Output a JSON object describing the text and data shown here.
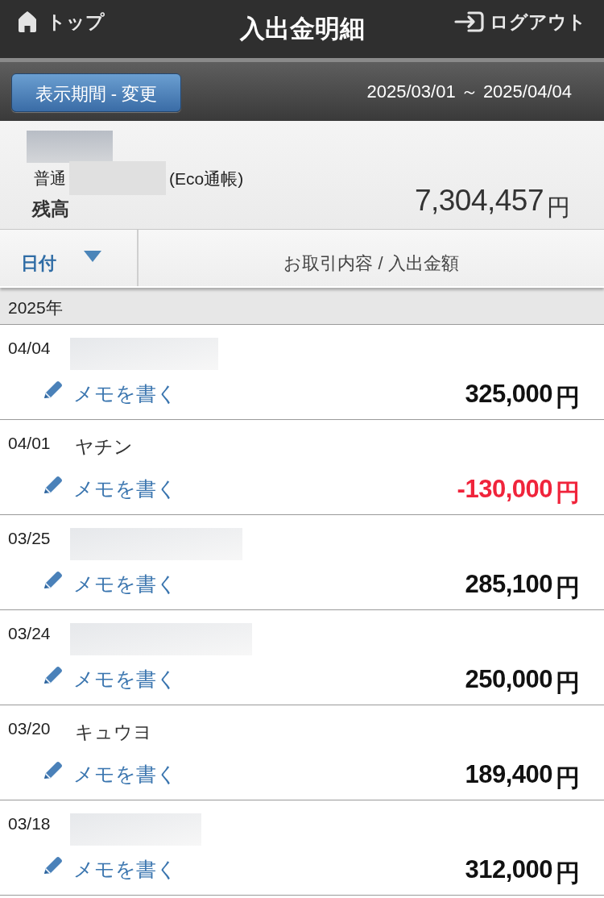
{
  "nav": {
    "home_label": "トップ",
    "title": "入出金明細",
    "logout_label": "ログアウト"
  },
  "toolbar": {
    "period_button": "表示期間 - 変更",
    "date_range": "2025/03/01 ～ 2025/04/04"
  },
  "account": {
    "name_redacted": true,
    "type": "普通",
    "number_redacted": true,
    "passbook": "(Eco通帳)",
    "balance_label": "残高",
    "balance": "7,304,457",
    "balance_unit": "円"
  },
  "columns": [
    {
      "label": "日付",
      "selected": true
    },
    {
      "label": "お取引内容 / 入出金額",
      "selected": false
    }
  ],
  "year_group": "2025年",
  "transactions": [
    {
      "date": "04/04",
      "redacted": true,
      "memo_link": "メモを書く",
      "amount": "325,000",
      "unit": "円",
      "negative": false
    },
    {
      "date": "04/01",
      "redacted": false,
      "description": "ヤチン",
      "memo_link": "メモを書く",
      "amount": "-130,000",
      "unit": "円",
      "negative": true
    },
    {
      "date": "03/25",
      "redacted": true,
      "memo_link": "メモを書く",
      "amount": "285,100",
      "unit": "円",
      "negative": false
    },
    {
      "date": "03/24",
      "redacted": true,
      "memo_link": "メモを書く",
      "amount": "250,000",
      "unit": "円",
      "negative": false
    },
    {
      "date": "03/20",
      "redacted": false,
      "description": "キュウヨ",
      "memo_link": "メモを書く",
      "amount": "189,400",
      "unit": "円",
      "negative": false
    },
    {
      "date": "03/18",
      "redacted": true,
      "memo_link": "メモを書く",
      "amount": "312,000",
      "unit": "円",
      "negative": false
    }
  ]
}
